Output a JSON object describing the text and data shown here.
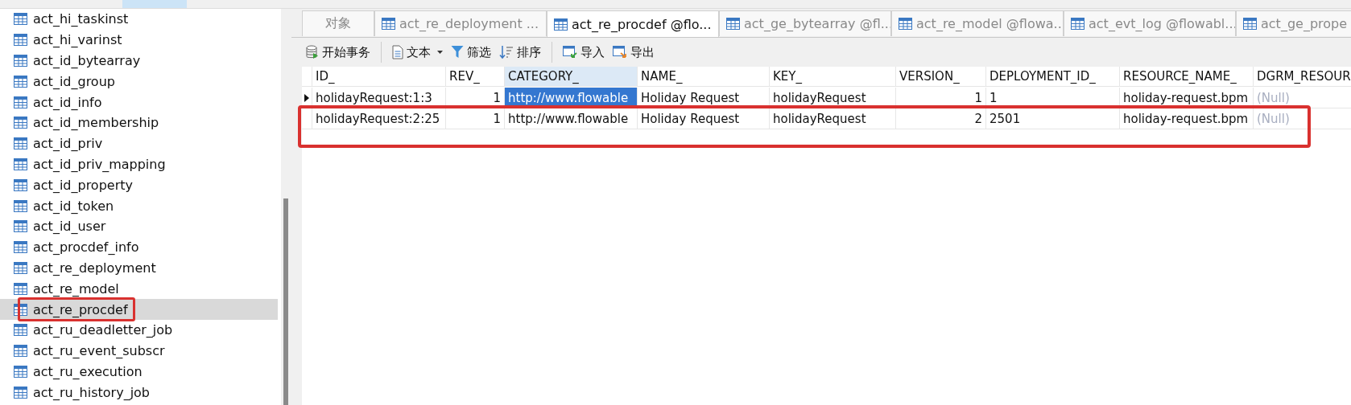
{
  "sidebar": {
    "items": [
      {
        "label": "act_hi_taskinst",
        "selected": false,
        "boxed": false
      },
      {
        "label": "act_hi_varinst",
        "selected": false,
        "boxed": false
      },
      {
        "label": "act_id_bytearray",
        "selected": false,
        "boxed": false
      },
      {
        "label": "act_id_group",
        "selected": false,
        "boxed": false
      },
      {
        "label": "act_id_info",
        "selected": false,
        "boxed": false
      },
      {
        "label": "act_id_membership",
        "selected": false,
        "boxed": false
      },
      {
        "label": "act_id_priv",
        "selected": false,
        "boxed": false
      },
      {
        "label": "act_id_priv_mapping",
        "selected": false,
        "boxed": false
      },
      {
        "label": "act_id_property",
        "selected": false,
        "boxed": false
      },
      {
        "label": "act_id_token",
        "selected": false,
        "boxed": false
      },
      {
        "label": "act_id_user",
        "selected": false,
        "boxed": false
      },
      {
        "label": "act_procdef_info",
        "selected": false,
        "boxed": false
      },
      {
        "label": "act_re_deployment",
        "selected": false,
        "boxed": false
      },
      {
        "label": "act_re_model",
        "selected": false,
        "boxed": false
      },
      {
        "label": "act_re_procdef",
        "selected": true,
        "boxed": true
      },
      {
        "label": "act_ru_deadletter_job",
        "selected": false,
        "boxed": false
      },
      {
        "label": "act_ru_event_subscr",
        "selected": false,
        "boxed": false
      },
      {
        "label": "act_ru_execution",
        "selected": false,
        "boxed": false
      },
      {
        "label": "act_ru_history_job",
        "selected": false,
        "boxed": false
      }
    ]
  },
  "tabs": [
    {
      "label": "对象",
      "kind": "objects",
      "selected": false
    },
    {
      "label": "act_re_deployment ...",
      "kind": "table",
      "selected": false
    },
    {
      "label": "act_re_procdef @flo...",
      "kind": "table",
      "selected": true
    },
    {
      "label": "act_ge_bytearray @fl...",
      "kind": "table",
      "selected": false
    },
    {
      "label": "act_re_model @flowa...",
      "kind": "table",
      "selected": false
    },
    {
      "label": "act_evt_log @flowabl...",
      "kind": "table",
      "selected": false
    },
    {
      "label": "act_ge_prope",
      "kind": "table",
      "selected": false
    }
  ],
  "toolbar": [
    {
      "label": "开始事务",
      "kind": "transaction"
    },
    {
      "kind": "separator"
    },
    {
      "label": "文本",
      "kind": "text-menu"
    },
    {
      "label": "筛选",
      "kind": "filter"
    },
    {
      "label": "排序",
      "kind": "sort"
    },
    {
      "kind": "separator"
    },
    {
      "label": "导入",
      "kind": "import"
    },
    {
      "label": "导出",
      "kind": "export"
    }
  ],
  "table": {
    "columns": [
      {
        "label": "ID_",
        "selected": false
      },
      {
        "label": "REV_",
        "selected": false
      },
      {
        "label": "CATEGORY_",
        "selected": true
      },
      {
        "label": "NAME_",
        "selected": false
      },
      {
        "label": "KEY_",
        "selected": false
      },
      {
        "label": "VERSION_",
        "selected": false
      },
      {
        "label": "DEPLOYMENT_ID_",
        "selected": false
      },
      {
        "label": "RESOURCE_NAME_",
        "selected": false
      },
      {
        "label": "DGRM_RESOUR",
        "selected": false
      }
    ],
    "rows": [
      {
        "selected": true,
        "boxed": false,
        "cells": [
          {
            "text": "holidayRequest:1:3",
            "kind": "text"
          },
          {
            "text": "1",
            "kind": "number"
          },
          {
            "text": "http://www.flowable",
            "kind": "text"
          },
          {
            "text": "Holiday Request",
            "kind": "text"
          },
          {
            "text": "holidayRequest",
            "kind": "text"
          },
          {
            "text": "1",
            "kind": "number"
          },
          {
            "text": "1",
            "kind": "text"
          },
          {
            "text": "holiday-request.bpm",
            "kind": "text"
          },
          {
            "text": "(Null)",
            "kind": "null"
          }
        ]
      },
      {
        "selected": false,
        "boxed": true,
        "cells": [
          {
            "text": "holidayRequest:2:25",
            "kind": "text"
          },
          {
            "text": "1",
            "kind": "number"
          },
          {
            "text": "http://www.flowable",
            "kind": "text"
          },
          {
            "text": "Holiday Request",
            "kind": "text"
          },
          {
            "text": "holidayRequest",
            "kind": "text"
          },
          {
            "text": "2",
            "kind": "number"
          },
          {
            "text": "2501",
            "kind": "text"
          },
          {
            "text": "holiday-request.bpm",
            "kind": "text"
          },
          {
            "text": "(Null)",
            "kind": "null"
          }
        ]
      }
    ]
  }
}
